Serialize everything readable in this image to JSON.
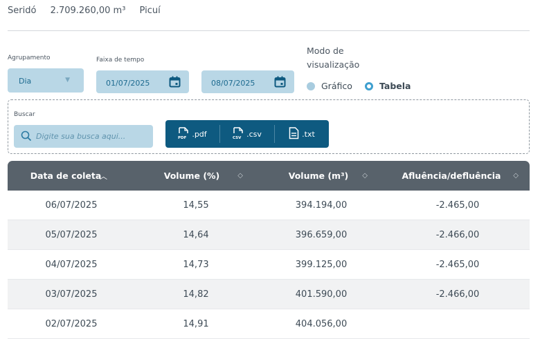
{
  "header": {
    "reservoir": "Seridó",
    "capacity": "2.709.260,00 m³",
    "location": "Picuí"
  },
  "filters": {
    "grouping_label": "Agrupamento",
    "grouping_value": "Dia",
    "time_range_label": "Faixa de tempo",
    "date_start": "01/07/2025",
    "date_end": "08/07/2025",
    "view_mode_label_1": "Modo de",
    "view_mode_label_2": "visualização",
    "view_options": [
      "Gráfico",
      "Tabela"
    ],
    "view_selected": "Tabela"
  },
  "search": {
    "label": "Buscar",
    "placeholder": "Digite sua busca aqui...",
    "exports": [
      ".pdf",
      ".csv",
      ".txt"
    ]
  },
  "table": {
    "columns": [
      "Data de coleta",
      "Volume (%)",
      "Volume (m³)",
      "Afluência/defluência"
    ],
    "sort_column": "Data de coleta",
    "rows": [
      [
        "06/07/2025",
        "14,55",
        "394.194,00",
        "-2.465,00"
      ],
      [
        "05/07/2025",
        "14,64",
        "396.659,00",
        "-2.466,00"
      ],
      [
        "04/07/2025",
        "14,73",
        "399.125,00",
        "-2.465,00"
      ],
      [
        "03/07/2025",
        "14,82",
        "401.590,00",
        "-2.466,00"
      ],
      [
        "02/07/2025",
        "14,91",
        "404.056,00",
        ""
      ]
    ]
  },
  "colors": {
    "accent": "#0e5a80",
    "field_bg": "#b9d7e6",
    "header_bg": "#58626b",
    "radio_active": "#3e9fcf"
  }
}
